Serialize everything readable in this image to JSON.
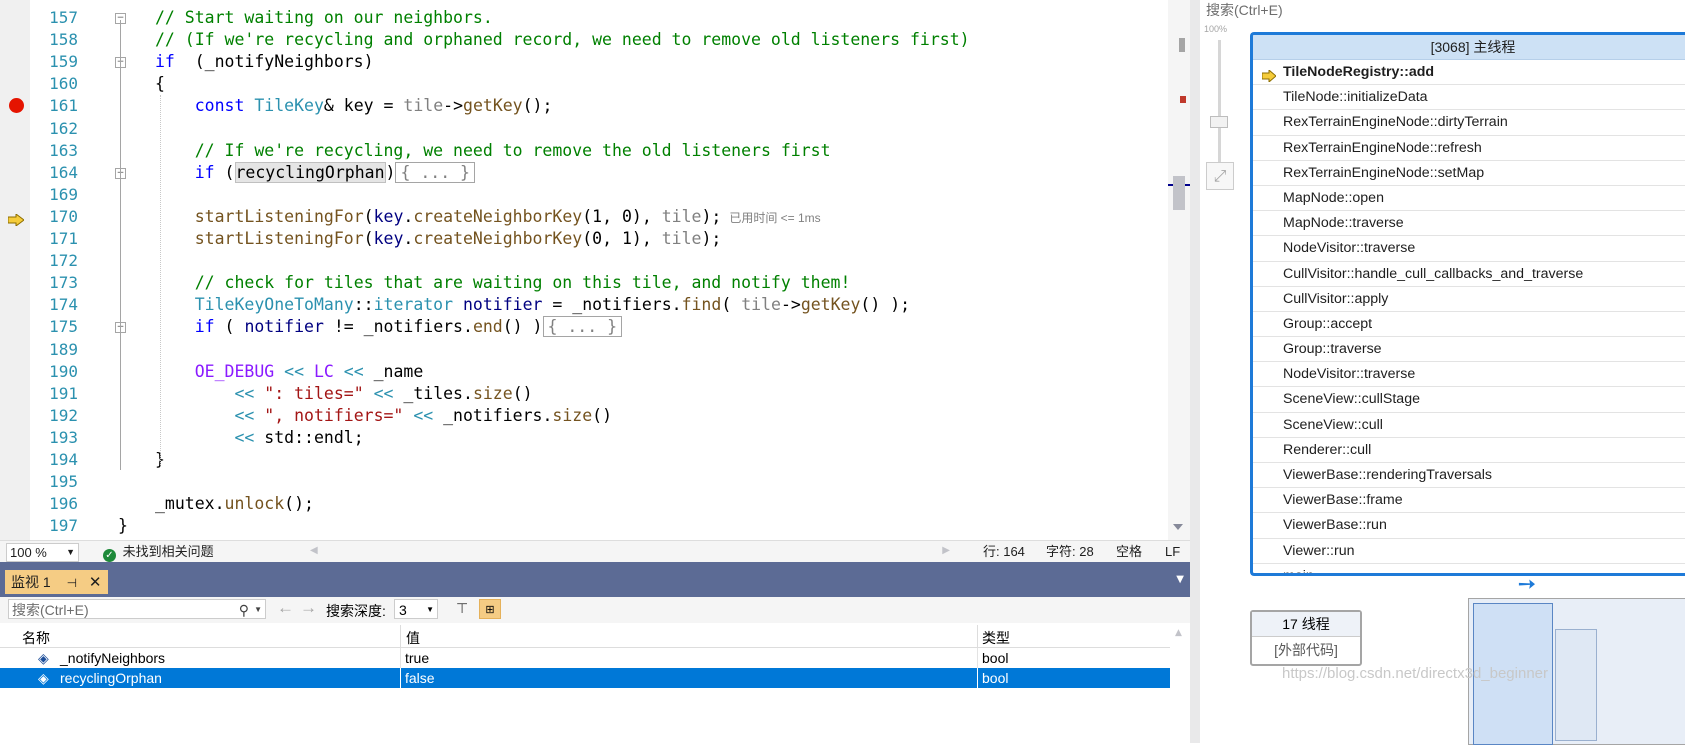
{
  "editor": {
    "lines": [
      {
        "num": "157",
        "segs": [
          [
            "c-com",
            "// Start waiting on our neighbors."
          ]
        ]
      },
      {
        "num": "158",
        "segs": [
          [
            "c-com",
            "// (If we're recycling and orphaned record, we need to remove old listeners first)"
          ]
        ]
      },
      {
        "num": "159",
        "segs": [
          [
            "c-kw",
            "if"
          ],
          [
            "",
            "  (_notifyNeighbors)"
          ]
        ]
      },
      {
        "num": "160",
        "segs": [
          [
            "",
            "{"
          ]
        ]
      },
      {
        "num": "161",
        "segs": [
          [
            "",
            "    "
          ],
          [
            "c-kw",
            "const"
          ],
          [
            "",
            " "
          ],
          [
            "c-type",
            "TileKey"
          ],
          [
            "",
            "& key = "
          ],
          [
            "c-param",
            "tile"
          ],
          [
            "",
            "->"
          ],
          [
            "c-fn",
            "getKey"
          ],
          [
            "",
            "();"
          ]
        ]
      },
      {
        "num": "162",
        "segs": [
          [
            "",
            ""
          ]
        ]
      },
      {
        "num": "163",
        "segs": [
          [
            "",
            "    "
          ],
          [
            "c-com",
            "// If we're recycling, we need to remove the old listeners first"
          ]
        ]
      },
      {
        "num": "164",
        "segs": [
          [
            "",
            "    "
          ],
          [
            "c-kw",
            "if"
          ],
          [
            "",
            " ("
          ],
          [
            "hlword",
            "recyclingOrphan"
          ],
          [
            "",
            ")"
          ],
          [
            "collapsed",
            "{ ... }"
          ]
        ]
      },
      {
        "num": "169",
        "segs": [
          [
            "",
            ""
          ]
        ]
      },
      {
        "num": "170",
        "segs": [
          [
            "",
            "    "
          ],
          [
            "c-fn",
            "startListeningFor"
          ],
          [
            "",
            "("
          ],
          [
            "c-member",
            "key"
          ],
          [
            "",
            "."
          ],
          [
            "c-fn",
            "createNeighborKey"
          ],
          [
            "",
            "(1, 0), "
          ],
          [
            "c-param",
            "tile"
          ],
          [
            "",
            ");"
          ]
        ]
      },
      {
        "num": "171",
        "segs": [
          [
            "",
            "    "
          ],
          [
            "c-fn",
            "startListeningFor"
          ],
          [
            "",
            "("
          ],
          [
            "c-member",
            "key"
          ],
          [
            "",
            "."
          ],
          [
            "c-fn",
            "createNeighborKey"
          ],
          [
            "",
            "(0, 1), "
          ],
          [
            "c-param",
            "tile"
          ],
          [
            "",
            ");"
          ]
        ]
      },
      {
        "num": "172",
        "segs": [
          [
            "",
            ""
          ]
        ]
      },
      {
        "num": "173",
        "segs": [
          [
            "",
            "    "
          ],
          [
            "c-com",
            "// check for tiles that are waiting on this tile, and notify them!"
          ]
        ]
      },
      {
        "num": "174",
        "segs": [
          [
            "",
            "    "
          ],
          [
            "c-type",
            "TileKeyOneToMany"
          ],
          [
            "",
            "::"
          ],
          [
            "c-type",
            "iterator"
          ],
          [
            "",
            " "
          ],
          [
            "c-member",
            "notifier"
          ],
          [
            "",
            " = _notifiers."
          ],
          [
            "c-fn",
            "find"
          ],
          [
            "",
            "( "
          ],
          [
            "c-param",
            "tile"
          ],
          [
            "",
            "->"
          ],
          [
            "c-fn",
            "getKey"
          ],
          [
            "",
            "() );"
          ]
        ]
      },
      {
        "num": "175",
        "segs": [
          [
            "",
            "    "
          ],
          [
            "c-kw",
            "if"
          ],
          [
            "",
            " ( "
          ],
          [
            "c-member",
            "notifier"
          ],
          [
            "",
            " != _notifiers."
          ],
          [
            "c-fn",
            "end"
          ],
          [
            "",
            "() )"
          ],
          [
            "collapsed",
            "{ ... }"
          ]
        ]
      },
      {
        "num": "189",
        "segs": [
          [
            "",
            ""
          ]
        ]
      },
      {
        "num": "190",
        "segs": [
          [
            "",
            "    "
          ],
          [
            "c-macro",
            "OE_DEBUG"
          ],
          [
            "",
            " "
          ],
          [
            "c-type",
            "<<"
          ],
          [
            "",
            " "
          ],
          [
            "c-macro",
            "LC"
          ],
          [
            "",
            " "
          ],
          [
            "c-type",
            "<<"
          ],
          [
            "",
            " _name"
          ]
        ]
      },
      {
        "num": "191",
        "segs": [
          [
            "",
            "        "
          ],
          [
            "c-type",
            "<<"
          ],
          [
            "",
            " "
          ],
          [
            "c-str",
            "\": tiles=\""
          ],
          [
            "",
            " "
          ],
          [
            "c-type",
            "<<"
          ],
          [
            "",
            " _tiles."
          ],
          [
            "c-fn",
            "size"
          ],
          [
            "",
            "()"
          ]
        ]
      },
      {
        "num": "192",
        "segs": [
          [
            "",
            "        "
          ],
          [
            "c-type",
            "<<"
          ],
          [
            "",
            " "
          ],
          [
            "c-str",
            "\", notifiers=\""
          ],
          [
            "",
            " "
          ],
          [
            "c-type",
            "<<"
          ],
          [
            "",
            " _notifiers."
          ],
          [
            "c-fn",
            "size"
          ],
          [
            "",
            "()"
          ]
        ]
      },
      {
        "num": "193",
        "segs": [
          [
            "",
            "        "
          ],
          [
            "c-type",
            "<<"
          ],
          [
            "",
            " std::endl;"
          ]
        ]
      },
      {
        "num": "194",
        "segs": [
          [
            "",
            "}"
          ]
        ]
      },
      {
        "num": "195",
        "segs": [
          [
            "",
            ""
          ]
        ]
      },
      {
        "num": "196",
        "segs": [
          [
            "",
            "_mutex."
          ],
          [
            "c-fn",
            "unlock"
          ],
          [
            "",
            "();"
          ]
        ]
      },
      {
        "num": "197",
        "segs": [
          [
            "",
            "}"
          ]
        ]
      }
    ],
    "elapsed_hint": "已用时间 <= 1ms"
  },
  "status": {
    "zoom": "100 %",
    "issues": "未找到相关问题",
    "line": "行: 164",
    "char": "字符: 28",
    "space": "空格",
    "eol": "LF"
  },
  "watch": {
    "tab_title": "监视 1",
    "search_placeholder": "搜索(Ctrl+E)",
    "depth_label": "搜索深度:",
    "depth_value": "3",
    "columns": [
      "名称",
      "值",
      "类型"
    ],
    "rows": [
      {
        "name": "_notifyNeighbors",
        "value": "true",
        "type": "bool",
        "selected": false
      },
      {
        "name": "recyclingOrphan",
        "value": "false",
        "type": "bool",
        "selected": true
      }
    ]
  },
  "parallel": {
    "search": "搜索(Ctrl+E)",
    "zoom_label": "100%",
    "thread_title": "[3068] 主线程",
    "frames": [
      "TileNodeRegistry::add",
      "TileNode::initializeData",
      "RexTerrainEngineNode::dirtyTerrain",
      "RexTerrainEngineNode::refresh",
      "RexTerrainEngineNode::setMap",
      "MapNode::open",
      "MapNode::traverse",
      "NodeVisitor::traverse",
      "CullVisitor::handle_cull_callbacks_and_traverse",
      "CullVisitor::apply",
      "Group::accept",
      "Group::traverse",
      "NodeVisitor::traverse",
      "SceneView::cullStage",
      "SceneView::cull",
      "Renderer::cull",
      "ViewerBase::renderingTraversals",
      "ViewerBase::frame",
      "ViewerBase::run",
      "Viewer::run",
      "main"
    ],
    "threads_count": "17 线程",
    "external_code": "[外部代码]",
    "watermark": "https://blog.csdn.net/directx3d_beginner"
  },
  "colors": {
    "accent": "#1e7ad8",
    "selection": "#0078d7",
    "tab_bar": "#5c6b95",
    "breakpoint": "#e51400"
  }
}
